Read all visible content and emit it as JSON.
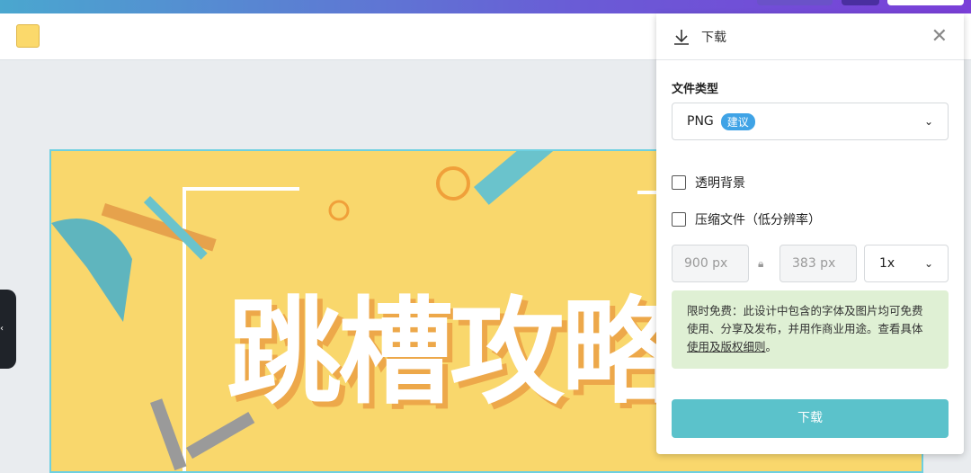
{
  "toolbar": {
    "swatch_color": "#fbd96b"
  },
  "design": {
    "headline": "跳槽攻略"
  },
  "sidebar": {
    "collapse_glyph": "‹"
  },
  "panel": {
    "title": "下载",
    "file_type_label": "文件类型",
    "file_type": "PNG",
    "file_type_badge": "建议",
    "transparent_bg": "透明背景",
    "compress": "压缩文件（低分辨率）",
    "width": "900 px",
    "height": "383 px",
    "scale": "1x",
    "note_text": "限时免费：此设计中包含的字体及图片均可免费使用、分享及发布，并用作商业用途。查看具体",
    "note_link": "使用及版权细则",
    "note_end": "。",
    "download_button": "下载"
  }
}
